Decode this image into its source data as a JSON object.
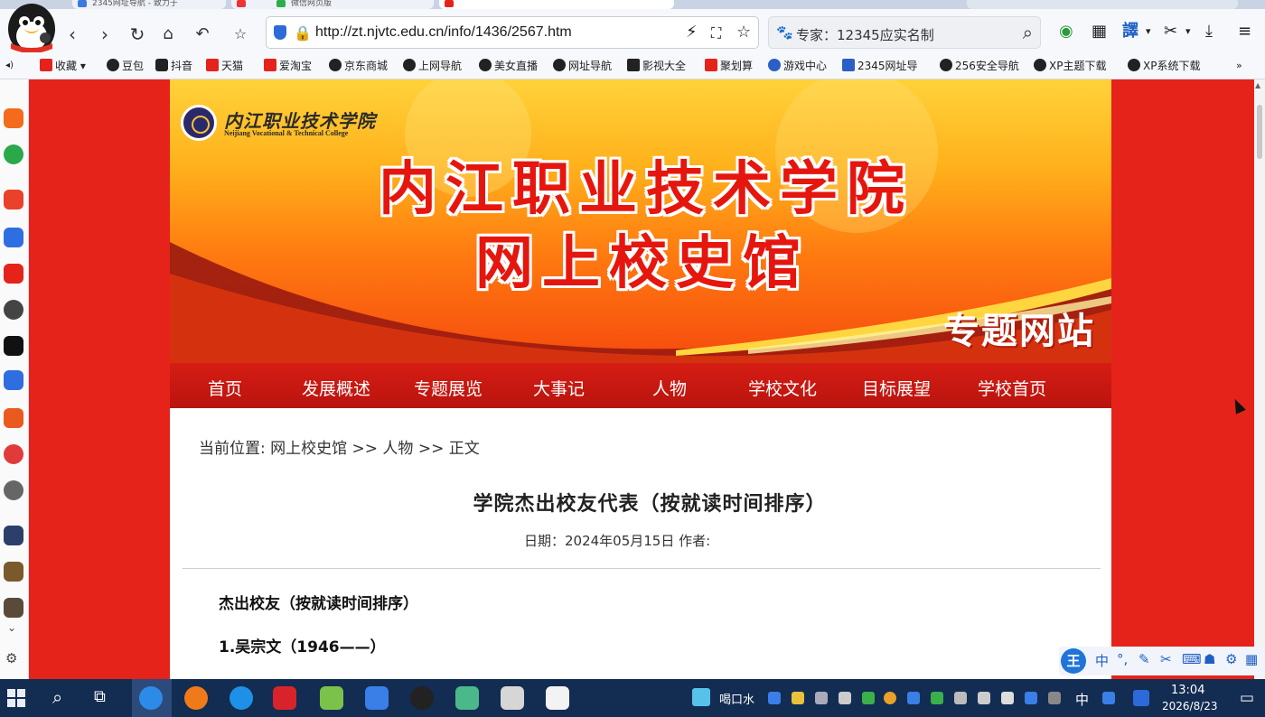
{
  "tabs": [
    {
      "label": "2345网址导航 - 致力于"
    },
    {
      "label": ""
    },
    {
      "label": "微信网页版"
    },
    {
      "label": ""
    }
  ],
  "toolbar": {
    "address": "http://zt.njvtc.edu.cn/info/1436/2567.htm",
    "search_text": "专家：12345应实名制"
  },
  "bookmarks": [
    {
      "label": "收藏"
    },
    {
      "label": "豆包"
    },
    {
      "label": "抖音"
    },
    {
      "label": "天猫"
    },
    {
      "label": "爱淘宝"
    },
    {
      "label": "京东商城"
    },
    {
      "label": "上网导航"
    },
    {
      "label": "美女直播"
    },
    {
      "label": "网址导航"
    },
    {
      "label": "影视大全"
    },
    {
      "label": "聚划算"
    },
    {
      "label": "游戏中心"
    },
    {
      "label": "2345网址导"
    },
    {
      "label": "256安全导航"
    },
    {
      "label": "XP主题下载"
    },
    {
      "label": "XP系统下载"
    }
  ],
  "banner": {
    "logo_cn": "内江职业技术学院",
    "logo_en": "Neijiang Vocational & Technical College",
    "title_line1": "内江职业技术学院",
    "title_line2": "网上校史馆",
    "subtitle": "专题网站"
  },
  "nav": [
    {
      "label": "首页"
    },
    {
      "label": "发展概述"
    },
    {
      "label": "专题展览"
    },
    {
      "label": "大事记"
    },
    {
      "label": "人物"
    },
    {
      "label": "学校文化"
    },
    {
      "label": "目标展望"
    },
    {
      "label": "学校首页"
    }
  ],
  "article": {
    "breadcrumb": "当前位置: 网上校史馆 >> 人物 >> 正文",
    "title": "学院杰出校友代表（按就读时间排序）",
    "meta": "日期：2024年05月15日    作者:",
    "heading": "杰出校友（按就读时间排序）",
    "para1": "1.吴宗文（1946——）"
  },
  "ime": {
    "logo": "王",
    "mode": "中"
  },
  "taskbar": {
    "tray_label": "喝口水",
    "ime_mode": "中",
    "time": "13:04",
    "date": "2026/8/23"
  },
  "colors": {
    "page_red": "#e5231b",
    "nav_red": "#c8170f",
    "accent_blue": "#2d6bd8"
  }
}
